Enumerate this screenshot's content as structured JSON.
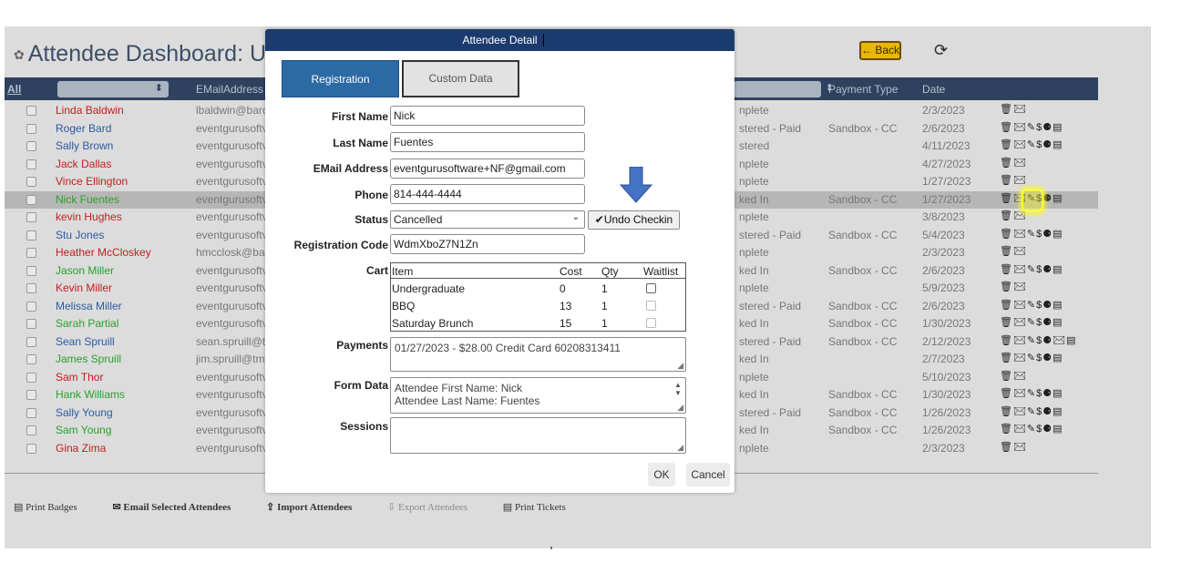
{
  "dashboard": {
    "title": "Attendee Dashboard: U",
    "logo_icon": "flower-icon",
    "back_label": "← Back",
    "refresh_icon": "refresh-icon",
    "columns": {
      "all": "All",
      "email": "EMailAddress",
      "payment": "Payment Type",
      "date": "Date"
    },
    "rows": [
      {
        "name": "Linda Baldwin",
        "color": "red",
        "email": "lbaldwin@barc",
        "status": "nplete",
        "payment": "",
        "date": "2/3/2023",
        "actions": "🗑✉"
      },
      {
        "name": "Roger Bard",
        "color": "blue",
        "email": "eventgurusoftv",
        "status": "stered - Paid",
        "payment": "Sandbox - CC",
        "date": "2/6/2023",
        "actions": "🗑✉✎$⚈▤"
      },
      {
        "name": "Sally Brown",
        "color": "blue",
        "email": "eventgurusoftv",
        "status": "stered",
        "payment": "",
        "date": "4/11/2023",
        "actions": "🗑✉✎$⚈▤"
      },
      {
        "name": "Jack Dallas",
        "color": "red",
        "email": "eventgurusoftv",
        "status": "nplete",
        "payment": "",
        "date": "4/27/2023",
        "actions": "🗑✉"
      },
      {
        "name": "Vince Ellington",
        "color": "red",
        "email": "eventgurusoftv",
        "status": "nplete",
        "payment": "",
        "date": "1/27/2023",
        "actions": "🗑✉"
      },
      {
        "name": "Nick Fuentes",
        "color": "green",
        "email": "eventgurusoftv",
        "status": "ked In",
        "payment": "Sandbox - CC",
        "date": "1/27/2023",
        "actions": "🗑✉✎$⚈▤"
      },
      {
        "name": "kevin Hughes",
        "color": "red",
        "email": "eventgurusoftv",
        "status": "nplete",
        "payment": "",
        "date": "3/8/2023",
        "actions": "🗑✉"
      },
      {
        "name": "Stu Jones",
        "color": "blue",
        "email": "eventgurusoftv",
        "status": "stered - Paid",
        "payment": "Sandbox - CC",
        "date": "5/4/2023",
        "actions": "🗑✉✎$⚈▤"
      },
      {
        "name": "Heather McCloskey",
        "color": "red",
        "email": "hmcclosk@ba",
        "status": "nplete",
        "payment": "",
        "date": "2/3/2023",
        "actions": "🗑✉"
      },
      {
        "name": "Jason Miller",
        "color": "green",
        "email": "eventgurusoftv",
        "status": "ked In",
        "payment": "Sandbox - CC",
        "date": "2/6/2023",
        "actions": "🗑✉✎$⚈▤"
      },
      {
        "name": "Kevin Miller",
        "color": "red",
        "email": "eventgurusoftv",
        "status": "nplete",
        "payment": "",
        "date": "5/9/2023",
        "actions": "🗑✉"
      },
      {
        "name": "Melissa Miller",
        "color": "blue",
        "email": "eventgurusoftv",
        "status": "stered - Paid",
        "payment": "Sandbox - CC",
        "date": "2/6/2023",
        "actions": "🗑✉✎$⚈▤"
      },
      {
        "name": "Sarah Partial",
        "color": "green",
        "email": "eventgurusoftv",
        "status": "ked In",
        "payment": "Sandbox - CC",
        "date": "1/30/2023",
        "actions": "🗑✉✎$⚈▤"
      },
      {
        "name": "Sean Spruill",
        "color": "blue",
        "email": "sean.spruill@t",
        "status": "stered - Paid",
        "payment": "Sandbox - CC",
        "date": "2/12/2023",
        "actions": "🗑✉✎$⚈✉▤"
      },
      {
        "name": "James Spruill",
        "color": "green",
        "email": "jim.spruill@tm",
        "status": "ked In",
        "payment": "",
        "date": "2/7/2023",
        "actions": "🗑✉✎$⚈▤"
      },
      {
        "name": "Sam Thor",
        "color": "red",
        "email": "eventgurusoftv",
        "status": "nplete",
        "payment": "",
        "date": "5/10/2023",
        "actions": "🗑✉"
      },
      {
        "name": "Hank Williams",
        "color": "green",
        "email": "eventgurusoftv",
        "status": "ked In",
        "payment": "Sandbox - CC",
        "date": "1/30/2023",
        "actions": "🗑✉✎$⚈▤"
      },
      {
        "name": "Sally Young",
        "color": "blue",
        "email": "eventgurusoftv",
        "status": "stered - Paid",
        "payment": "Sandbox - CC",
        "date": "1/26/2023",
        "actions": "🗑✉✎$⚈▤"
      },
      {
        "name": "Sam Young",
        "color": "green",
        "email": "eventgurusoftv",
        "status": "ked In",
        "payment": "Sandbox - CC",
        "date": "1/26/2023",
        "actions": "🗑✉✎$⚈▤"
      },
      {
        "name": "Gina Zima",
        "color": "red",
        "email": "eventgurusoftv",
        "status": "nplete",
        "payment": "",
        "date": "2/3/2023",
        "actions": "🗑✉"
      }
    ],
    "footer": {
      "print_badges": "Print Badges",
      "email_selected": "Email Selected Attendees",
      "import": "Import Attendees",
      "export": "Export Attendees",
      "print_tickets": "Print Tickets"
    }
  },
  "dialog": {
    "title": "Attendee Detail",
    "tabs": {
      "registration": "Registration",
      "custom": "Custom Data"
    },
    "labels": {
      "first_name": "First Name",
      "last_name": "Last Name",
      "email": "EMail Address",
      "phone": "Phone",
      "status": "Status",
      "reg_code": "Registration Code",
      "cart": "Cart",
      "payments": "Payments",
      "form_data": "Form Data",
      "sessions": "Sessions"
    },
    "values": {
      "first_name": "Nick",
      "last_name": "Fuentes",
      "email": "eventgurusoftware+NF@gmail.com",
      "phone": "814-444-4444",
      "status": "Cancelled",
      "reg_code": "WdmXboZ7N1Zn",
      "payments": "01/27/2023 - $28.00 Credit Card  60208313411",
      "form_data_line1": "Attendee First Name: Nick",
      "form_data_line2": "Attendee Last Name: Fuentes",
      "sessions": ""
    },
    "undo_checkin": "✔Undo Checkin",
    "cart": {
      "headers": {
        "item": "Item",
        "cost": "Cost",
        "qty": "Qty",
        "waitlist": "Waitlist"
      },
      "items": [
        {
          "item": "Undergraduate",
          "cost": "0",
          "qty": "1"
        },
        {
          "item": "BBQ",
          "cost": "13",
          "qty": "1"
        },
        {
          "item": "Saturday Brunch",
          "cost": "15",
          "qty": "1"
        }
      ]
    },
    "ok": "OK",
    "cancel": "Cancel"
  },
  "colors": {
    "header": "#2e4260",
    "dialog_title": "#1b3b6e",
    "tab_active": "#2c6aa6",
    "back_button": "#e8b800",
    "arrow": "#4472c4",
    "highlight": "#ffff33"
  }
}
